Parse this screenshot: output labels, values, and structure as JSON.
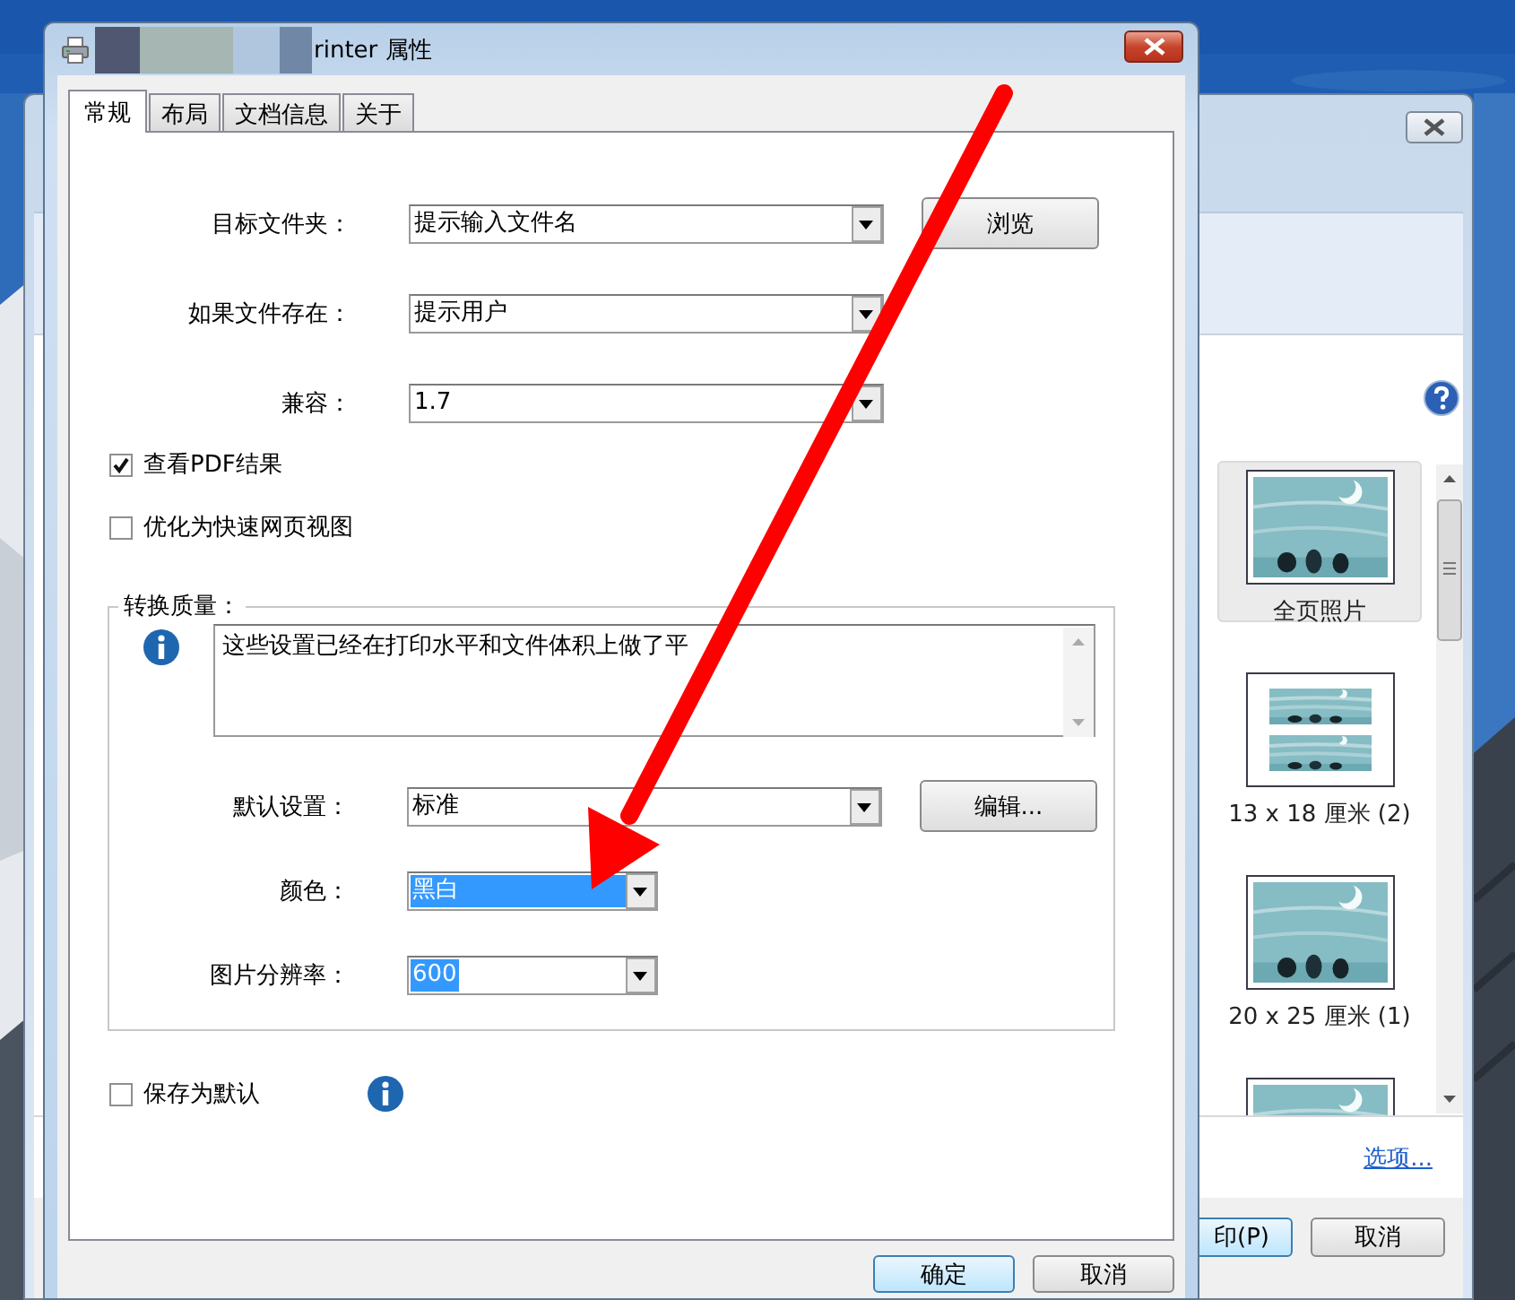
{
  "print_window": {
    "items": [
      {
        "kind": "single",
        "label": "全页照片",
        "selected": true
      },
      {
        "kind": "double",
        "label": "13 x 18 厘米 (2)",
        "selected": false
      },
      {
        "kind": "single",
        "label": "20 x 25 厘米 (1)",
        "selected": false
      },
      {
        "kind": "single",
        "selected": false
      }
    ],
    "options_link": "选项...",
    "buttons": [
      {
        "label": "印(P)",
        "default": true
      },
      {
        "label": "取消",
        "default": false
      }
    ]
  },
  "dialog": {
    "title": "rinter 属性",
    "tabs": [
      {
        "label": "常规",
        "selected": true
      },
      {
        "label": "布局",
        "selected": false
      },
      {
        "label": "文档信息",
        "selected": false
      },
      {
        "label": "关于",
        "selected": false
      }
    ],
    "fields": [
      {
        "label": "目标文件夹：",
        "value": "提示输入文件名",
        "button": "浏览"
      },
      {
        "label": "如果文件存在：",
        "value": "提示用户"
      },
      {
        "label": "兼容：",
        "value": "1.7"
      }
    ],
    "checkboxes": [
      {
        "label": "查看PDF结果",
        "checked": true
      },
      {
        "label": "优化为快速网页视图",
        "checked": false
      }
    ],
    "quality": {
      "title": "转换质量：",
      "info": "这些设置已经在打印水平和文件体积上做了平",
      "fields": [
        {
          "label": "默认设置：",
          "value": "标准",
          "button": "编辑...",
          "kind": "wide",
          "focused": false,
          "text_selected": false
        },
        {
          "label": "颜色：",
          "value": "黑白",
          "kind": "narrow",
          "focused": true,
          "text_selected": false
        },
        {
          "label": "图片分辨率：",
          "value": "600",
          "kind": "narrow",
          "focused": false,
          "text_selected": true
        }
      ]
    },
    "save_default": {
      "label": "保存为默认",
      "checked": false
    },
    "buttons": [
      {
        "label": "确定",
        "default": true
      },
      {
        "label": "取消",
        "default": false
      }
    ]
  }
}
